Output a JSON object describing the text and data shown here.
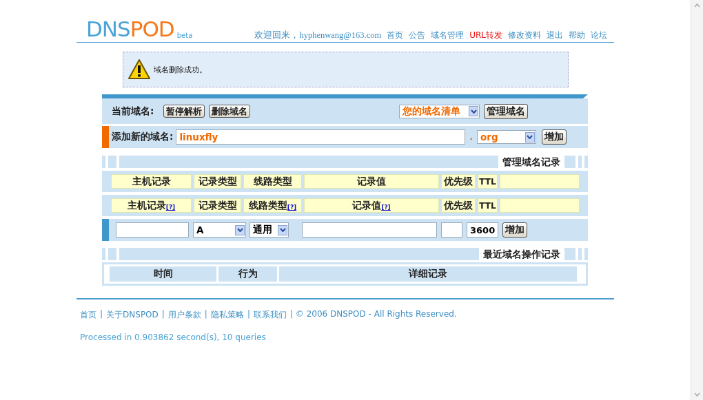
{
  "header": {
    "logo": {
      "parts": [
        "DNS",
        "POD"
      ],
      "tag": "beta"
    },
    "greeting": "欢迎回来，hyphenwang@163.com",
    "nav": [
      {
        "label": "首页",
        "highlighted": false
      },
      {
        "label": "公告",
        "highlighted": false
      },
      {
        "label": "域名管理",
        "highlighted": false
      },
      {
        "label": "URL转发",
        "highlighted": true
      },
      {
        "label": "修改资料",
        "highlighted": false
      },
      {
        "label": "退出",
        "highlighted": false
      },
      {
        "label": "帮助",
        "highlighted": false
      },
      {
        "label": "论坛",
        "highlighted": false
      }
    ]
  },
  "notice": {
    "message": "域名删除成功。"
  },
  "domain_bar": {
    "label": "当前域名:",
    "buttons": [
      "暂停解析",
      "删除域名"
    ],
    "domain_select": "您的域名清单",
    "manage_button": "管理域名"
  },
  "add_domain": {
    "label": "添加新的域名:",
    "value": "linuxfly",
    "dot": ".",
    "tld": "org",
    "button": "增加"
  },
  "records": {
    "title": "管理域名记录",
    "header_rows": [
      [
        {
          "label": "主机记录"
        },
        {
          "label": "记录类型"
        },
        {
          "label": "线路类型"
        },
        {
          "label": "记录值"
        },
        {
          "label": "优先级"
        },
        {
          "label": "TTL"
        },
        {}
      ],
      [
        {
          "label": "主机记录",
          "help": "[?]"
        },
        {
          "label": "记录类型"
        },
        {
          "label": "线路类型",
          "help": "[?]"
        },
        {
          "label": "记录值",
          "help": "[?]"
        },
        {
          "label": "优先级"
        },
        {
          "label": "TTL"
        },
        {}
      ]
    ],
    "new_row": {
      "type": "A",
      "line": "通用",
      "ttl": "3600",
      "button": "增加"
    }
  },
  "log": {
    "title": "最近域名操作记录",
    "columns": [
      "时间",
      "行为",
      "详细记录"
    ]
  },
  "footer": {
    "links": [
      {
        "label": "首页"
      },
      {
        "prefix": "|",
        "label": "关于DNSPOD"
      },
      {
        "prefix": "|",
        "label": "用户条款"
      },
      {
        "prefix": "|",
        "label": "隐私策略"
      },
      {
        "prefix": "|",
        "label": "联系我们"
      }
    ],
    "copyright": "| © 2006 DNSPOD - All Rights Reserved.",
    "stats": "Processed in 0.903862 second(s), 10 queries"
  }
}
